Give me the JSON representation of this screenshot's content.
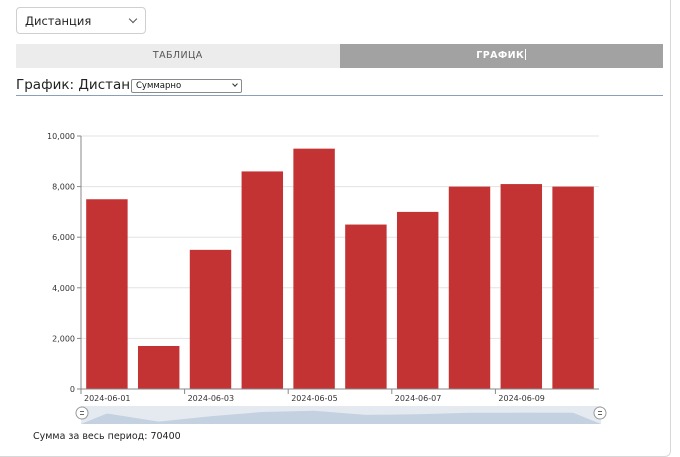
{
  "metric_select": {
    "value": "Дистанция",
    "icon": "chevron-down-icon"
  },
  "tabs": [
    {
      "label": "ТАБЛИЦА",
      "active": false
    },
    {
      "label": "ГРАФИК",
      "active": true
    }
  ],
  "chart_heading": {
    "title": "График: Дистанция",
    "mode_value": "Суммарно"
  },
  "chart_data": {
    "type": "bar",
    "categories": [
      "2024-06-01",
      "2024-06-02",
      "2024-06-03",
      "2024-06-04",
      "2024-06-05",
      "2024-06-06",
      "2024-06-07",
      "2024-06-08",
      "2024-06-09",
      "2024-06-10"
    ],
    "values": [
      7500,
      1700,
      5500,
      8600,
      9500,
      6500,
      7000,
      8000,
      8100,
      8000
    ],
    "x_tick_labels": [
      "2024-06-01",
      "2024-06-03",
      "2024-06-05",
      "2024-06-07",
      "2024-06-09"
    ],
    "y_ticks": [
      "0",
      "2,000",
      "4,000",
      "6,000",
      "8,000",
      "10,000"
    ],
    "ylim": [
      0,
      10000
    ],
    "grid": true,
    "bar_color": "#c43333",
    "title": "",
    "xlabel": "",
    "ylabel": ""
  },
  "summary": {
    "text": "Сумма за весь период: 70400"
  }
}
